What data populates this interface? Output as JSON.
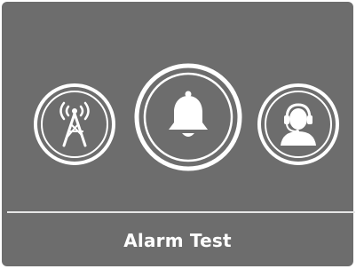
{
  "screen": {
    "title": "Alarm Test"
  },
  "buttons": [
    {
      "icon": "radio-tower-icon"
    },
    {
      "icon": "bell-icon"
    },
    {
      "icon": "support-agent-headset-icon"
    }
  ],
  "colors": {
    "background": "#6d6d6d",
    "foreground": "#ffffff",
    "divider": "#e6e6e6"
  }
}
